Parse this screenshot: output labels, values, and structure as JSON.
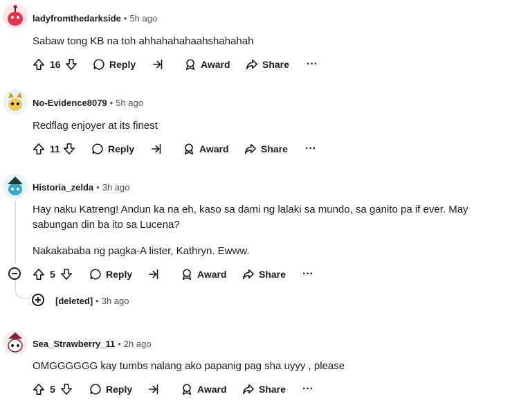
{
  "comments": [
    {
      "author": "ladyfromthedarkside",
      "time": "5h ago",
      "text": "Sabaw tong KB na toh ahhahahahaahshahahah",
      "votes": "16",
      "reply": "Reply",
      "award": "Award",
      "share": "Share",
      "more": "···"
    },
    {
      "author": "No-Evidence8079",
      "time": "5h ago",
      "text": "Redflag enjoyer at its finest",
      "votes": "11",
      "reply": "Reply",
      "award": "Award",
      "share": "Share",
      "more": "···"
    },
    {
      "author": "Historia_zelda",
      "time": "3h ago",
      "text": "Hay naku Katreng! Andun ka na eh, kaso sa dami ng lalaki sa mundo, sa ganito pa if ever. May sabungan din ba ito sa Lucena?",
      "text2": "Nakakababa ng pagka-A lister, Kathryn. Ewww.",
      "votes": "5",
      "reply": "Reply",
      "award": "Award",
      "share": "Share",
      "more": "···"
    },
    {
      "author": "Sea_Strawberry_11",
      "time": "2h ago",
      "text": "OMGGGGGG kay tumbs nalang ako papanig pag sha uyyy , please",
      "votes": "5",
      "reply": "Reply",
      "award": "Award",
      "share": "Share",
      "more": "···"
    }
  ],
  "deleted": {
    "author": "[deleted]",
    "time": "3h ago"
  },
  "separator": "•",
  "colors": {
    "avatar1": "#e8334a",
    "avatar2": "#f2c94c",
    "avatar3": "#3aa6c9",
    "avatar4": "#8b1e2d",
    "text": "#1c1c1c",
    "muted": "#555555",
    "thread": "#e0e0e0"
  }
}
